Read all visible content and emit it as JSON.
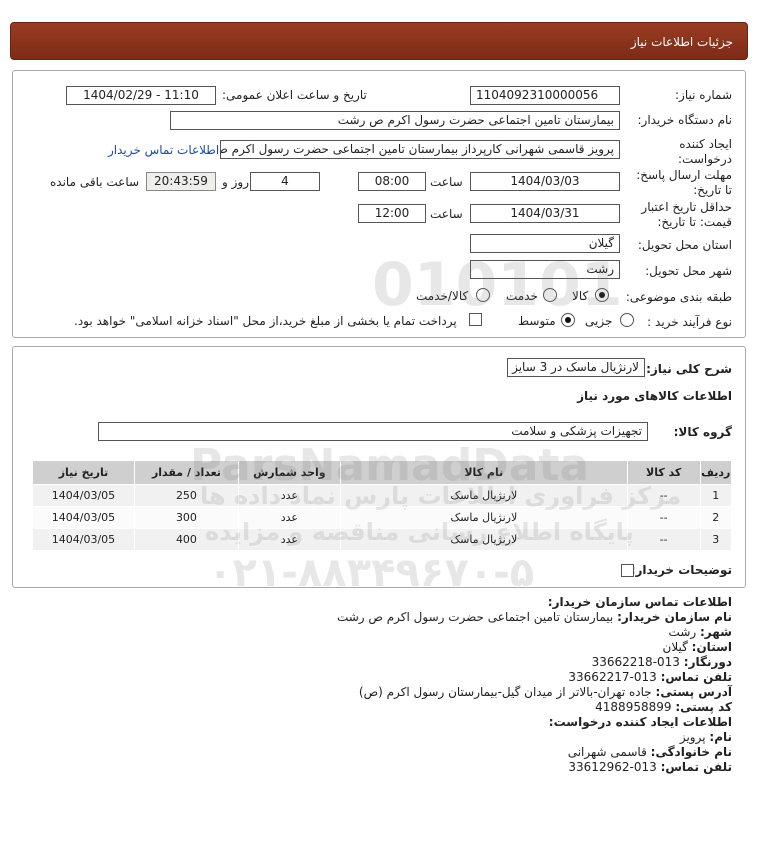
{
  "header": {
    "title": "جزئیات اطلاعات نیاز"
  },
  "form": {
    "need_number_label": "شماره نیاز:",
    "need_number": "1104092310000056",
    "announce_label": "تاریخ و ساعت اعلان عمومی:",
    "announce_value": "1404/02/29 - 11:10",
    "buyer_org_label": "نام دستگاه خریدار:",
    "buyer_org": "بیمارستان  تامین اجتماعی حضرت رسول اکرم ص رشت",
    "creator_label_1": "ایجاد کننده",
    "creator_label_2": "درخواست:",
    "creator": "پرویز قاسمی شهرانی کارپرداز بیمارستان  تامین اجتماعی حضرت رسول اکرم ص رشت",
    "buyer_contact_link": "اطلاعات تماس خریدار",
    "deadline_label_1": "مهلت ارسال پاسخ:",
    "deadline_label_2": "تا تاریخ:",
    "deadline_date": "1404/03/03",
    "time_label": "ساعت",
    "deadline_time": "08:00",
    "days_value": "4",
    "days_label": "روز و",
    "remaining_time": "20:43:59",
    "remaining_label": "ساعت باقی مانده",
    "validity_label_1": "حداقل تاریخ اعتبار",
    "validity_label_2": "قیمت: تا تاریخ:",
    "validity_date": "1404/03/31",
    "validity_time": "12:00",
    "province_label": "استان محل تحویل:",
    "province": "گیلان",
    "city_label": "شهر محل تحویل:",
    "city": "رشت",
    "category_label": "طبقه بندی موضوعی:",
    "category_options": [
      "کالا",
      "خدمت",
      "کالا/خدمت"
    ],
    "category_selected": "کالا",
    "process_label": "نوع فرآیند خرید :",
    "process_options": [
      "جزیی",
      "متوسط"
    ],
    "process_selected": "متوسط",
    "payment_note": "پرداخت تمام یا بخشی از مبلغ خرید،از محل \"اسناد خزانه اسلامی\" خواهد بود."
  },
  "details": {
    "summary_label": "شرح کلی نیاز:",
    "summary": "لارنژیال ماسک در 3 سایز",
    "goods_info_title": "اطلاعات کالاهای مورد نیاز",
    "goods_group_label": "گروه کالا:",
    "goods_group": "تجهیزات پزشکی و سلامت",
    "table": {
      "headers": [
        "ردیف",
        "کد کالا",
        "نام کالا",
        "واحد شمارش",
        "تعداد / مقدار",
        "تاریخ نیاز"
      ],
      "rows": [
        [
          "1",
          "--",
          "لارنژیال ماسک",
          "عدد",
          "250",
          "1404/03/05"
        ],
        [
          "2",
          "--",
          "لارنژیال ماسک",
          "عدد",
          "300",
          "1404/03/05"
        ],
        [
          "3",
          "--",
          "لارنژیال ماسک",
          "عدد",
          "400",
          "1404/03/05"
        ]
      ]
    },
    "buyer_notes_label": "توضیحات خریدار:"
  },
  "contact": {
    "org_title": "اطلاعات تماس سازمان خریدار:",
    "org_name_label": "نام سازمان خریدار:",
    "org_name": "بیمارستان تامین اجتماعی حضرت رسول اکرم ص رشت",
    "city_label": "شهر:",
    "city": "رشت",
    "province_label": "استان:",
    "province": "گیلان",
    "fax_label": "دورنگار:",
    "fax": "013-33662218",
    "phone_label": "تلفن تماس:",
    "phone": "013-33662217",
    "address_label": "آدرس پستی:",
    "address": "جاده تهران-بالاتر از میدان گیل-بیمارستان رسول اکرم (ص)",
    "postal_label": "کد پستی:",
    "postal": "4188958899",
    "creator_title": "اطلاعات ایجاد کننده درخواست:",
    "first_name_label": "نام:",
    "first_name": "پرویز",
    "last_name_label": "نام خانوادگی:",
    "last_name": "قاسمی شهرانی",
    "creator_phone_label": "تلفن تماس:",
    "creator_phone": "013-33612962"
  },
  "watermark": {
    "line1": "ParsNamadData",
    "line2": "مرکز فراوری اطلاعات پارس نماد داده ها",
    "line3": "پایگاه اطلاع رسانی مناقصه و مزایده",
    "phone": "۰۲۱-۸۸۳۴۹۶۷۰-۵",
    "number": "010101"
  }
}
